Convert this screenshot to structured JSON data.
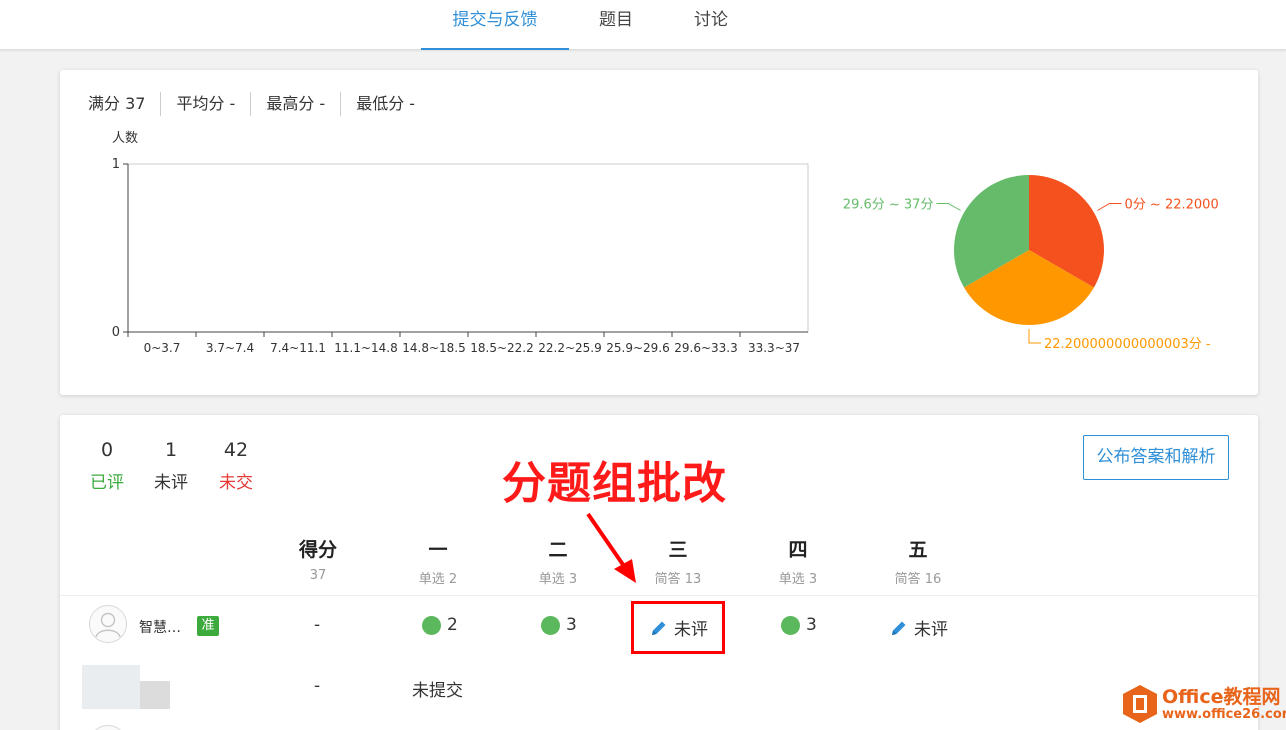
{
  "nav": {
    "tabs": [
      {
        "label": "提交与反馈",
        "active": true
      },
      {
        "label": "题目",
        "active": false
      },
      {
        "label": "讨论",
        "active": false
      }
    ]
  },
  "summary": {
    "full_score": "满分 37",
    "average": "平均分 -",
    "highest": "最高分 -",
    "lowest": "最低分 -"
  },
  "chart_data": [
    {
      "type": "bar",
      "ylabel": "人数",
      "ylim": [
        0,
        1
      ],
      "yticks": [
        "0",
        "1"
      ],
      "categories": [
        "0~3.7",
        "3.7~7.4",
        "7.4~11.1",
        "11.1~14.8",
        "14.8~18.5",
        "18.5~22.2",
        "22.2~25.9",
        "25.9~29.6",
        "29.6~33.3",
        "33.3~37"
      ],
      "values": [
        0,
        0,
        0,
        0,
        0,
        0,
        0,
        0,
        0,
        0
      ]
    },
    {
      "type": "pie",
      "slices": [
        {
          "label": "0分 ~ 22.2000",
          "value": 1,
          "color": "#f4511e"
        },
        {
          "label": "22.200000000000003分 -",
          "value": 1,
          "color": "#ff9800"
        },
        {
          "label": "29.6分 ~ 37分",
          "value": 1,
          "color": "#66bb6a"
        }
      ]
    }
  ],
  "counts": [
    {
      "num": "0",
      "label": "已评",
      "color": "#3daa3d"
    },
    {
      "num": "1",
      "label": "未评",
      "color": "#333333"
    },
    {
      "num": "42",
      "label": "未交",
      "color": "#e53935"
    }
  ],
  "publish_button": "公布答案和解析",
  "annotation": "分题组批改",
  "columns": [
    {
      "title": "得分",
      "sub": "37"
    },
    {
      "title": "一",
      "sub": "单选 2"
    },
    {
      "title": "二",
      "sub": "单选 3"
    },
    {
      "title": "三",
      "sub": "简答 13"
    },
    {
      "title": "四",
      "sub": "单选 3"
    },
    {
      "title": "五",
      "sub": "简答 16"
    }
  ],
  "rows": [
    {
      "name": "智慧…",
      "badge": "准",
      "score": "-",
      "q1": "2",
      "q2": "3",
      "q3": "未评",
      "q4": "3",
      "q5": "未评"
    },
    {
      "score": "-",
      "status": "未提交"
    }
  ],
  "watermark": {
    "line1": "Office教程网",
    "line2": "www.office26.com"
  }
}
